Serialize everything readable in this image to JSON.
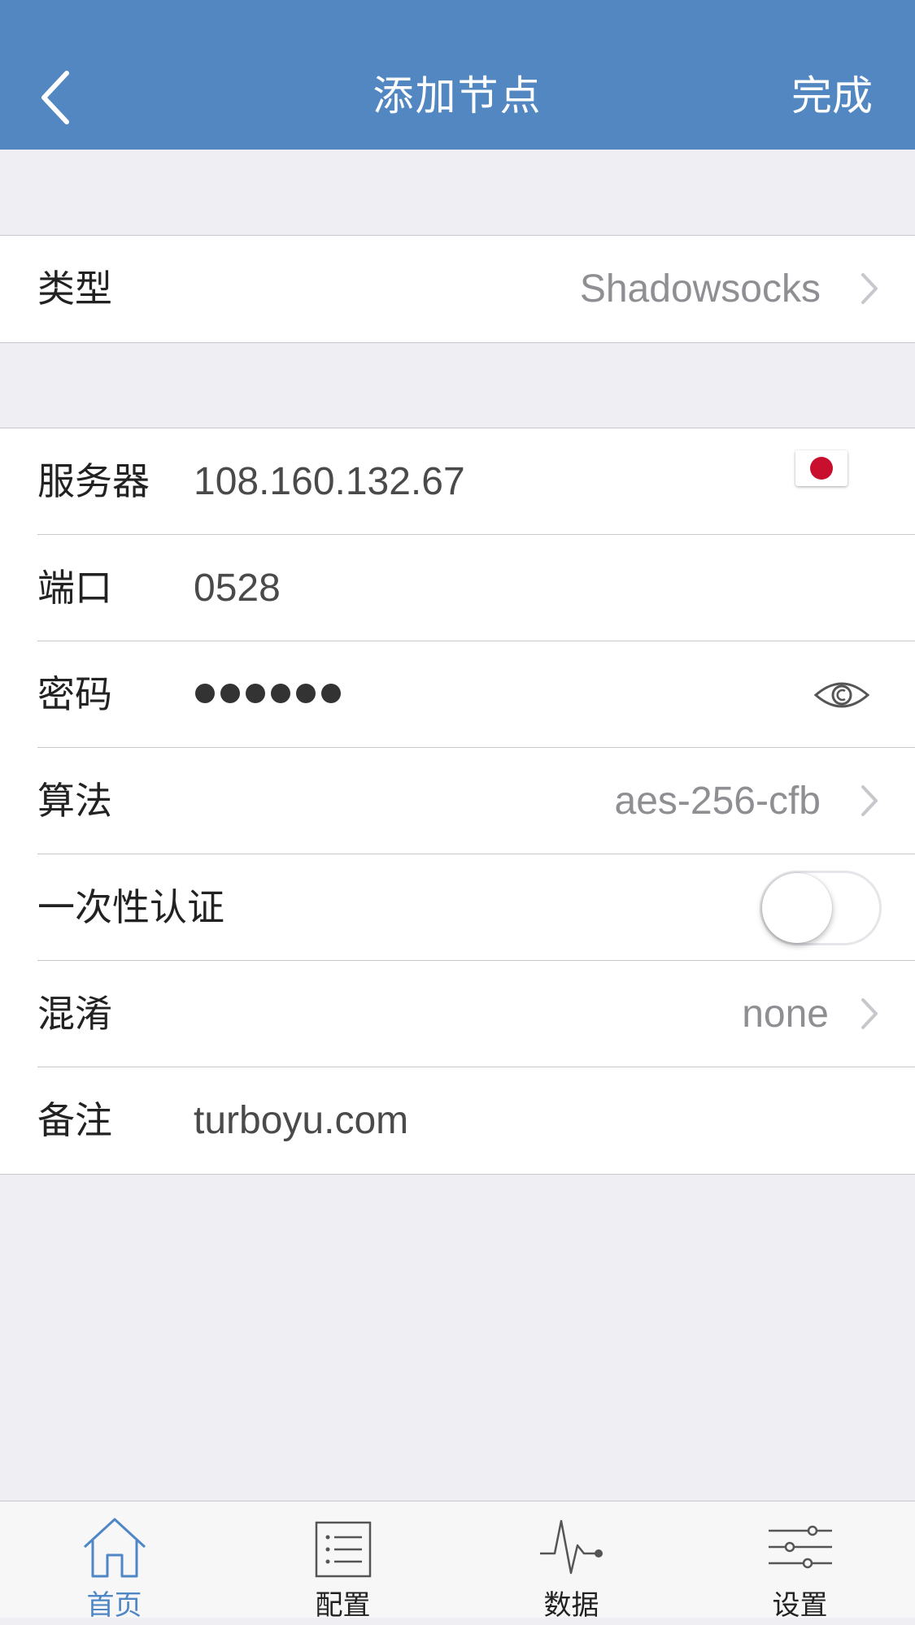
{
  "nav": {
    "title": "添加节点",
    "done_label": "完成",
    "back_icon": "chevron-left-icon",
    "bg_color": "#5287c2"
  },
  "type_row": {
    "label": "类型",
    "value": "Shadowsocks"
  },
  "form": {
    "server": {
      "label": "服务器",
      "value": "108.160.132.67",
      "flag_icon": "japan-flag-icon"
    },
    "port": {
      "label": "端口",
      "value": "0528"
    },
    "password": {
      "label": "密码",
      "masked_count": 6,
      "reveal_icon": "eye-icon"
    },
    "cipher": {
      "label": "算法",
      "value": "aes-256-cfb"
    },
    "ota": {
      "label": "一次性认证",
      "enabled": false
    },
    "obfs": {
      "label": "混淆",
      "value": "none"
    },
    "remark": {
      "label": "备注",
      "value": "turboyu.com"
    }
  },
  "tabbar": {
    "active_color": "#4f86c6",
    "items": [
      {
        "label": "首页",
        "icon": "home-icon",
        "active": true
      },
      {
        "label": "配置",
        "icon": "list-icon",
        "active": false
      },
      {
        "label": "数据",
        "icon": "activity-icon",
        "active": false
      },
      {
        "label": "设置",
        "icon": "sliders-icon",
        "active": false
      }
    ]
  }
}
